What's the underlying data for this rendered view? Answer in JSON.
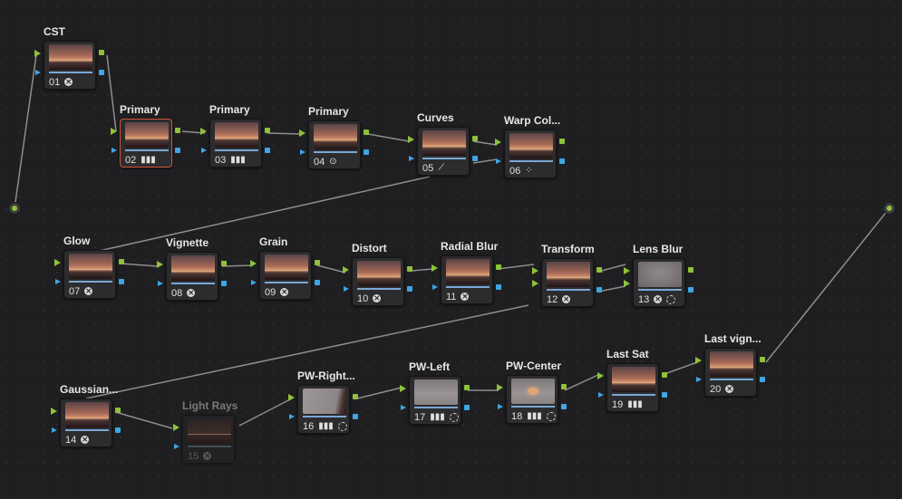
{
  "graph": {
    "input_terminal": "input-rgb-terminal",
    "output_terminal": "output-rgb-terminal",
    "nodes": [
      {
        "id": "01",
        "label": "CST",
        "tool": "x-icon"
      },
      {
        "id": "02",
        "label": "Primary",
        "tool": "primary-bars-icon",
        "selected": true
      },
      {
        "id": "03",
        "label": "Primary",
        "tool": "primary-bars-icon"
      },
      {
        "id": "04",
        "label": "Primary",
        "tool": "circle-dot-icon"
      },
      {
        "id": "05",
        "label": "Curves",
        "tool": "curves-icon"
      },
      {
        "id": "06",
        "label": "Warp Col...",
        "tool": "warp-dots-icon"
      },
      {
        "id": "07",
        "label": "Glow",
        "tool": "x-icon"
      },
      {
        "id": "08",
        "label": "Vignette",
        "tool": "x-icon"
      },
      {
        "id": "09",
        "label": "Grain",
        "tool": "x-icon"
      },
      {
        "id": "10",
        "label": "Distort",
        "tool": "x-icon"
      },
      {
        "id": "11",
        "label": "Radial Blur",
        "tool": "x-icon"
      },
      {
        "id": "12",
        "label": "Transform",
        "tool": "x-icon"
      },
      {
        "id": "13",
        "label": "Lens Blur",
        "tool": "x-window-icon"
      },
      {
        "id": "14",
        "label": "Gaussian...",
        "tool": "x-icon"
      },
      {
        "id": "15",
        "label": "Light Rays",
        "tool": "x-icon",
        "disabled": true
      },
      {
        "id": "16",
        "label": "PW-Right...",
        "tool": "bars-window-icon"
      },
      {
        "id": "17",
        "label": "PW-Left",
        "tool": "bars-window-icon"
      },
      {
        "id": "18",
        "label": "PW-Center",
        "tool": "bars-window-icon"
      },
      {
        "id": "19",
        "label": "Last Sat",
        "tool": "primary-bars-icon"
      },
      {
        "id": "20",
        "label": "Last vign...",
        "tool": "x-icon"
      }
    ]
  }
}
